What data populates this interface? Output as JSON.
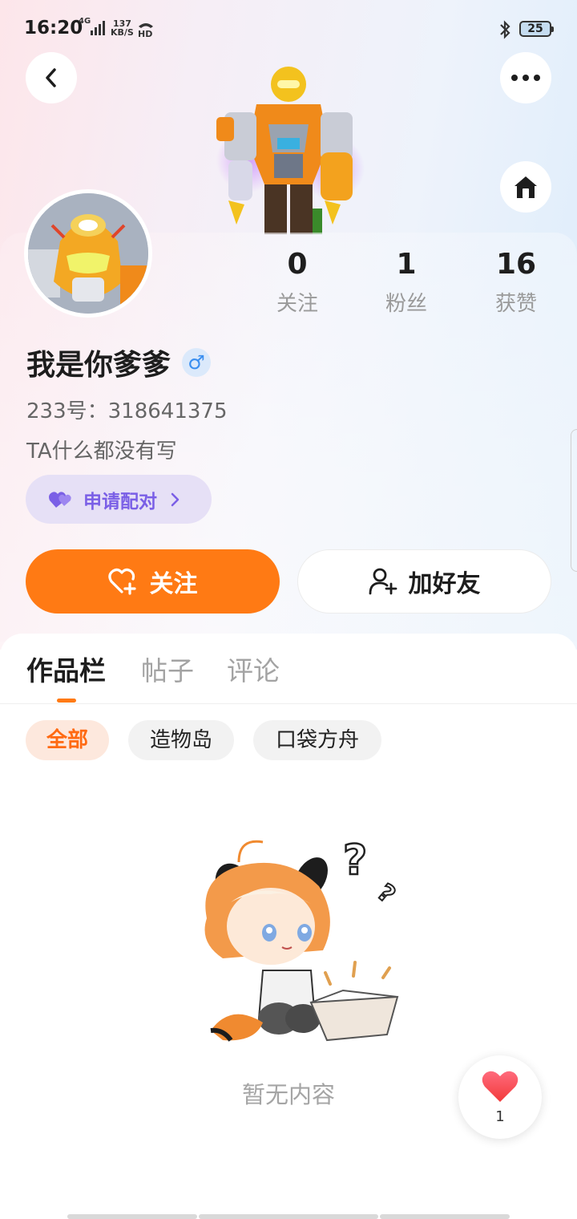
{
  "status_bar": {
    "time": "16:20",
    "network": "4G",
    "speed_value": "137",
    "speed_unit": "KB/S",
    "battery": "25"
  },
  "profile": {
    "name": "我是你爹爹",
    "gender_symbol": "♂",
    "uid": "233号：318641375",
    "bio": "TA什么都没有写",
    "pair_button": "申请配对",
    "stats": [
      {
        "value": "0",
        "label": "关注"
      },
      {
        "value": "1",
        "label": "粉丝"
      },
      {
        "value": "16",
        "label": "获赞"
      }
    ]
  },
  "actions": {
    "follow": "关注",
    "add_friend": "加好友"
  },
  "tabs": [
    "作品栏",
    "帖子",
    "评论"
  ],
  "filters": [
    "全部",
    "造物岛",
    "口袋方舟"
  ],
  "empty_state": "暂无内容",
  "floating_like": {
    "count": "1"
  },
  "colors": {
    "accent": "#ff7a14",
    "pair_purple": "#7a5fe6",
    "gender_blue": "#3a8ef0"
  }
}
